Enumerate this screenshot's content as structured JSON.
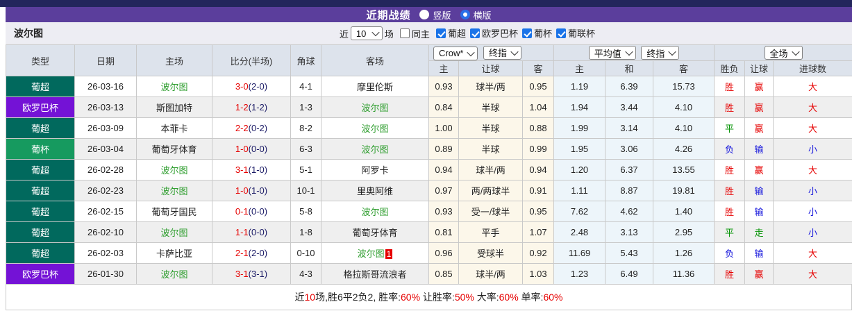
{
  "title_bar": {
    "title": "近期战绩",
    "radio_vertical": "竖版",
    "radio_horizontal": "横版",
    "selected": "横版"
  },
  "filter_bar": {
    "team": "波尔图",
    "near_label": "近",
    "matches_value": "10",
    "matches_label": "场",
    "same_home_label": "同主",
    "same_home_checked": false,
    "leagues": [
      {
        "label": "葡超",
        "checked": true
      },
      {
        "label": "欧罗巴杯",
        "checked": true
      },
      {
        "label": "葡杯",
        "checked": true
      },
      {
        "label": "葡联杯",
        "checked": true
      }
    ]
  },
  "table": {
    "headers": {
      "type": "类型",
      "date": "日期",
      "home": "主场",
      "score": "比分(半场)",
      "corner": "角球",
      "away": "客场",
      "asia_home": "主",
      "asia_line": "让球",
      "asia_away": "客",
      "euro_home": "主",
      "euro_draw": "和",
      "euro_away": "客",
      "result_wdl": "胜负",
      "result_handicap": "让球",
      "result_goals": "进球数"
    },
    "dropdowns": {
      "asia_source": "Crow*",
      "asia_time": "终指",
      "euro_source": "平均值",
      "euro_time": "终指",
      "result_scope": "全场"
    },
    "rows": [
      {
        "type": "葡超",
        "type_color": "teal",
        "date": "26-03-16",
        "home": "波尔图",
        "home_team": true,
        "score": "3-0",
        "half": "(2-0)",
        "corner": "4-1",
        "away": "摩里伦斯",
        "away_team": false,
        "away_badge": "",
        "ah": "0.93",
        "line": "球半/两",
        "aa": "0.95",
        "eh": "1.19",
        "ed": "6.39",
        "ea": "15.73",
        "wdl": "胜",
        "wdl_c": "red",
        "hcp": "赢",
        "hcp_c": "red",
        "goals": "大",
        "goals_c": "red"
      },
      {
        "type": "欧罗巴杯",
        "type_color": "purple",
        "date": "26-03-13",
        "home": "斯图加特",
        "home_team": false,
        "score": "1-2",
        "half": "(1-2)",
        "corner": "1-3",
        "away": "波尔图",
        "away_team": true,
        "away_badge": "",
        "ah": "0.84",
        "line": "半球",
        "aa": "1.04",
        "eh": "1.94",
        "ed": "3.44",
        "ea": "4.10",
        "wdl": "胜",
        "wdl_c": "red",
        "hcp": "赢",
        "hcp_c": "red",
        "goals": "大",
        "goals_c": "red"
      },
      {
        "type": "葡超",
        "type_color": "teal",
        "date": "26-03-09",
        "home": "本菲卡",
        "home_team": false,
        "score": "2-2",
        "half": "(0-2)",
        "corner": "8-2",
        "away": "波尔图",
        "away_team": true,
        "away_badge": "",
        "ah": "1.00",
        "line": "半球",
        "aa": "0.88",
        "eh": "1.99",
        "ed": "3.14",
        "ea": "4.10",
        "wdl": "平",
        "wdl_c": "green",
        "hcp": "赢",
        "hcp_c": "red",
        "goals": "大",
        "goals_c": "red"
      },
      {
        "type": "葡杯",
        "type_color": "green",
        "date": "26-03-04",
        "home": "葡萄牙体育",
        "home_team": false,
        "score": "1-0",
        "half": "(0-0)",
        "corner": "6-3",
        "away": "波尔图",
        "away_team": true,
        "away_badge": "",
        "ah": "0.89",
        "line": "半球",
        "aa": "0.99",
        "eh": "1.95",
        "ed": "3.06",
        "ea": "4.26",
        "wdl": "负",
        "wdl_c": "blue",
        "hcp": "输",
        "hcp_c": "blue",
        "goals": "小",
        "goals_c": "blue"
      },
      {
        "type": "葡超",
        "type_color": "teal",
        "date": "26-02-28",
        "home": "波尔图",
        "home_team": true,
        "score": "3-1",
        "half": "(1-0)",
        "corner": "5-1",
        "away": "阿罗卡",
        "away_team": false,
        "away_badge": "",
        "ah": "0.94",
        "line": "球半/两",
        "aa": "0.94",
        "eh": "1.20",
        "ed": "6.37",
        "ea": "13.55",
        "wdl": "胜",
        "wdl_c": "red",
        "hcp": "赢",
        "hcp_c": "red",
        "goals": "大",
        "goals_c": "red"
      },
      {
        "type": "葡超",
        "type_color": "teal",
        "date": "26-02-23",
        "home": "波尔图",
        "home_team": true,
        "score": "1-0",
        "half": "(1-0)",
        "corner": "10-1",
        "away": "里奥阿维",
        "away_team": false,
        "away_badge": "",
        "ah": "0.97",
        "line": "两/两球半",
        "aa": "0.91",
        "eh": "1.11",
        "ed": "8.87",
        "ea": "19.81",
        "wdl": "胜",
        "wdl_c": "red",
        "hcp": "输",
        "hcp_c": "blue",
        "goals": "小",
        "goals_c": "blue"
      },
      {
        "type": "葡超",
        "type_color": "teal",
        "date": "26-02-15",
        "home": "葡萄牙国民",
        "home_team": false,
        "score": "0-1",
        "half": "(0-0)",
        "corner": "5-8",
        "away": "波尔图",
        "away_team": true,
        "away_badge": "",
        "ah": "0.93",
        "line": "受一/球半",
        "aa": "0.95",
        "eh": "7.62",
        "ed": "4.62",
        "ea": "1.40",
        "wdl": "胜",
        "wdl_c": "red",
        "hcp": "输",
        "hcp_c": "blue",
        "goals": "小",
        "goals_c": "blue"
      },
      {
        "type": "葡超",
        "type_color": "teal",
        "date": "26-02-10",
        "home": "波尔图",
        "home_team": true,
        "score": "1-1",
        "half": "(0-0)",
        "corner": "1-8",
        "away": "葡萄牙体育",
        "away_team": false,
        "away_badge": "",
        "ah": "0.81",
        "line": "平手",
        "aa": "1.07",
        "eh": "2.48",
        "ed": "3.13",
        "ea": "2.95",
        "wdl": "平",
        "wdl_c": "green",
        "hcp": "走",
        "hcp_c": "green",
        "goals": "小",
        "goals_c": "blue"
      },
      {
        "type": "葡超",
        "type_color": "teal",
        "date": "26-02-03",
        "home": "卡萨比亚",
        "home_team": false,
        "score": "2-1",
        "half": "(2-0)",
        "corner": "0-10",
        "away": "波尔图",
        "away_team": true,
        "away_badge": "1",
        "ah": "0.96",
        "line": "受球半",
        "aa": "0.92",
        "eh": "11.69",
        "ed": "5.43",
        "ea": "1.26",
        "wdl": "负",
        "wdl_c": "blue",
        "hcp": "输",
        "hcp_c": "blue",
        "goals": "大",
        "goals_c": "red"
      },
      {
        "type": "欧罗巴杯",
        "type_color": "purple",
        "date": "26-01-30",
        "home": "波尔图",
        "home_team": true,
        "score": "3-1",
        "half": "(3-1)",
        "corner": "4-3",
        "away": "格拉斯哥流浪者",
        "away_team": false,
        "away_badge": "",
        "ah": "0.85",
        "line": "球半/两",
        "aa": "1.03",
        "eh": "1.23",
        "ed": "6.49",
        "ea": "11.36",
        "wdl": "胜",
        "wdl_c": "red",
        "hcp": "赢",
        "hcp_c": "red",
        "goals": "大",
        "goals_c": "red"
      }
    ]
  },
  "footer": {
    "segments": [
      {
        "text": "近",
        "color": "dark"
      },
      {
        "text": "10",
        "color": "red"
      },
      {
        "text": "场,胜6平2负2, 胜率:",
        "color": "dark"
      },
      {
        "text": "60%",
        "color": "red"
      },
      {
        "text": " 让胜率:",
        "color": "dark"
      },
      {
        "text": "50%",
        "color": "red"
      },
      {
        "text": " 大率:",
        "color": "dark"
      },
      {
        "text": "60%",
        "color": "red"
      },
      {
        "text": " 单率:",
        "color": "dark"
      },
      {
        "text": "60%",
        "color": "red"
      }
    ]
  },
  "colors": {
    "bar_navy": "#23265c",
    "bar_purple": "#5b3e9c",
    "badge_teal": "#01695d",
    "badge_purple": "#7412d6",
    "badge_cup_green": "#169a5f",
    "team_green": "#2f9e2f",
    "result_red": "#e60000",
    "result_green": "#079407",
    "result_blue": "#1616dc",
    "checkbox_blue": "#1a73e8",
    "asia_col_bg": "#fcf7ea",
    "euro_col_bg": "#edf5fa"
  }
}
